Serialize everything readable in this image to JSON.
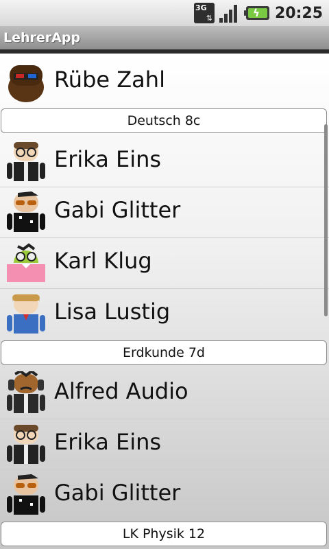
{
  "status_bar": {
    "network_label": "3G",
    "network_icon": "3g-data-icon",
    "signal_icon": "signal-strength-icon",
    "battery_icon": "battery-charging-icon",
    "time": "20:25"
  },
  "app_bar": {
    "title": "LehrerApp"
  },
  "colors": {
    "battery_fill": "#7ac943",
    "title_bar": "#9e9e9e",
    "header_border": "#8c8c8c"
  },
  "list": {
    "owner": {
      "name": "Rübe Zahl",
      "avatar_icon": "bearded-android-avatar"
    },
    "groups": [
      {
        "label": "Deutsch 8c",
        "students": [
          {
            "name": "Erika Eins",
            "avatar_icon": "glasses-android-avatar"
          },
          {
            "name": "Gabi Glitter",
            "avatar_icon": "sunglasses-android-avatar"
          },
          {
            "name": "Karl Klug",
            "avatar_icon": "nerd-android-avatar"
          },
          {
            "name": "Lisa Lustig",
            "avatar_icon": "blonde-android-avatar"
          }
        ]
      },
      {
        "label": "Erdkunde 7d",
        "students": [
          {
            "name": "Alfred Audio",
            "avatar_icon": "headphones-android-avatar"
          },
          {
            "name": "Erika Eins",
            "avatar_icon": "glasses-android-avatar"
          },
          {
            "name": "Gabi Glitter",
            "avatar_icon": "sunglasses-android-avatar"
          }
        ]
      },
      {
        "label": "LK Physik 12",
        "students": []
      }
    ]
  }
}
